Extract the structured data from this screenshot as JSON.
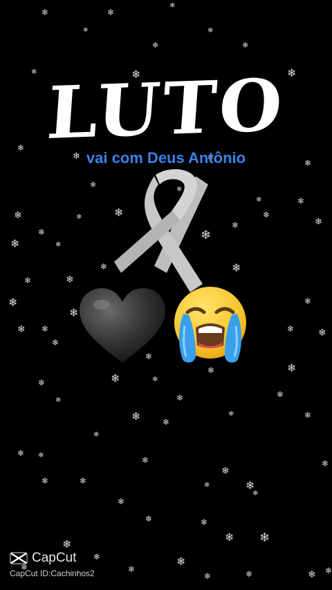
{
  "title": "LUTO",
  "subtitle": "vai com Deus Antônio",
  "icons": [
    "awareness-ribbon-icon",
    "black-heart-icon",
    "crying-face-icon",
    "snowflake-icon",
    "capcut-logo-icon"
  ],
  "colors": {
    "background": "#000000",
    "title": "#ffffff",
    "subtitle": "#3b82ea",
    "ribbon": "#c8c8c8",
    "heart": "#3a3a3a",
    "emoji_face": "#f7c52b",
    "tears": "#3aa0ee",
    "snow": "#d9d9d9"
  },
  "watermark": {
    "brand": "CapCut",
    "id_text": "CapCut ID:Cachinhos2"
  }
}
